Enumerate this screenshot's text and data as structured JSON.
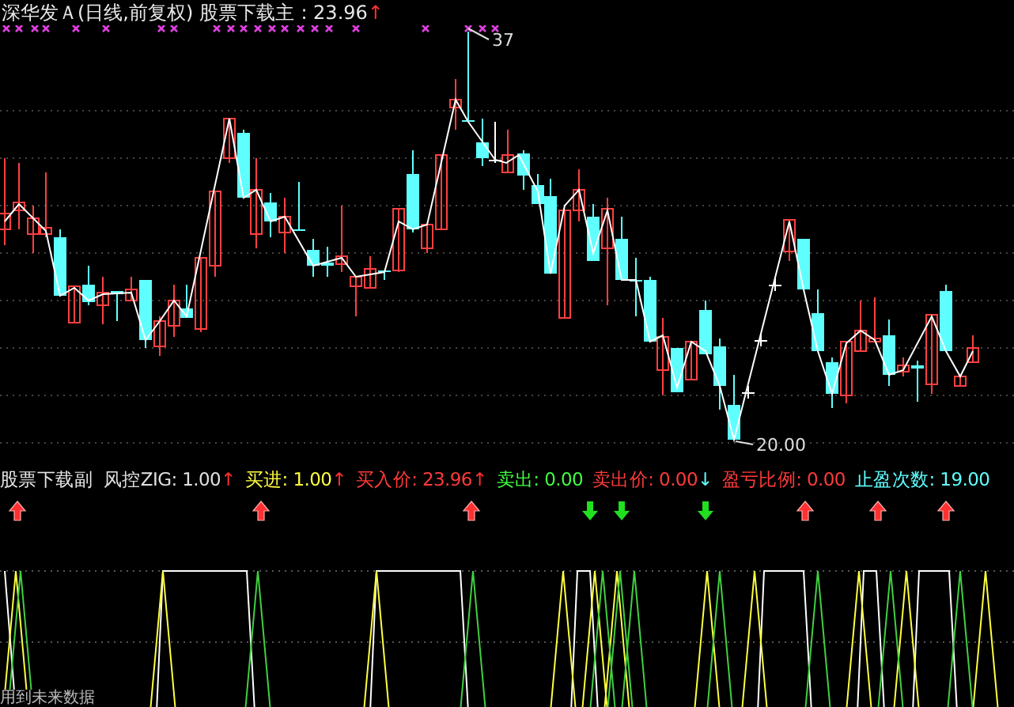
{
  "header": {
    "title": "深华发Ａ(日线,前复权)",
    "indicator": "股票下载主",
    "value": ": 23.96",
    "arrow": "↑"
  },
  "price_labels": [
    {
      "kind": "high",
      "text": "37"
    },
    {
      "kind": "low",
      "text": "20.00"
    }
  ],
  "sub_title": "股票下载副",
  "indicators": [
    {
      "text": "风控ZIG: 1.00",
      "color": "#e0e0e0",
      "arrow": {
        "text": "↑",
        "color": "#ff3030"
      }
    },
    {
      "text": "买进: 1.00",
      "color": "#ffff40",
      "arrow": {
        "text": "↑",
        "color": "#ff3030"
      }
    },
    {
      "text": "买入价: 23.96",
      "color": "#ff3a3a",
      "arrow": {
        "text": "↑",
        "color": "#ff3030"
      }
    },
    {
      "text": "卖出: 0.00",
      "color": "#40ff40"
    },
    {
      "text": "卖出价: 0.00",
      "color": "#ff3a3a",
      "arrow": {
        "text": "↓",
        "color": "#60ffff"
      }
    },
    {
      "text": "盈亏比例: 0.00",
      "color": "#ff3a3a"
    },
    {
      "text": "止盈次数: 19.00",
      "color": "#60ffff"
    }
  ],
  "signals": [
    {
      "kind": "buy"
    },
    {
      "kind": "buy"
    },
    {
      "kind": "buy"
    },
    {
      "kind": "sell"
    },
    {
      "kind": "sell"
    },
    {
      "kind": "sell"
    },
    {
      "kind": "buy"
    },
    {
      "kind": "buy"
    },
    {
      "kind": "buy"
    }
  ],
  "footnote": "用到未来数据"
}
